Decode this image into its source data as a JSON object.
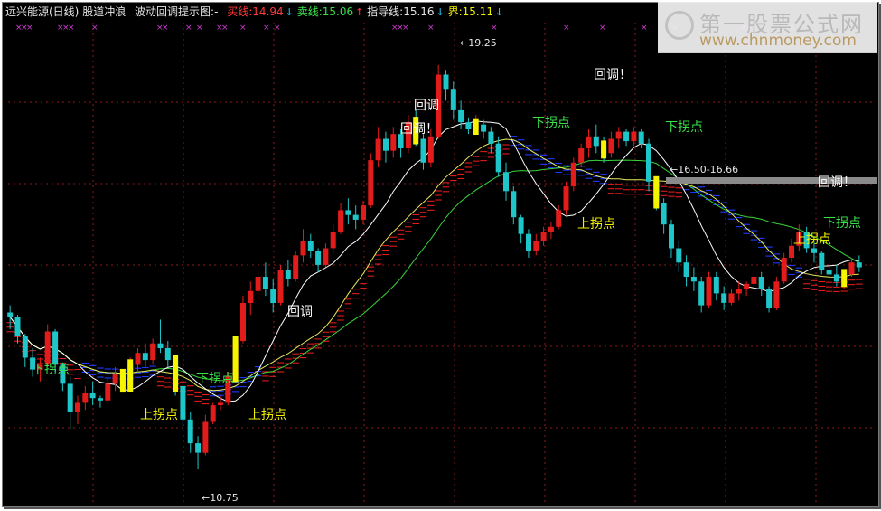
{
  "title_bar": {
    "stock": "远兴能源(日线)",
    "indicator": "股道冲浪",
    "prompt_label": "波动回调提示图:-",
    "buy_label": "买线:",
    "buy_value": "14.94",
    "sell_label": "卖线:",
    "sell_value": "15.06",
    "guide_label": "指导线:",
    "guide_value": "15.16",
    "bound_label": "界:",
    "bound_value": "15.11"
  },
  "watermark": {
    "cn": "第一股票公式网",
    "en": "www.chnmoney.com"
  },
  "colors": {
    "background": "#000000",
    "up": "#e21b1b",
    "down": "#1fc6c9",
    "signal": "#f5f500",
    "ma_white": "#ffffff",
    "ma_yellow": "#e8e860",
    "ma_green": "#39d43a",
    "band_blue": "#1f3aff",
    "band_red": "#e21b1b",
    "grid": "#8a1a1a"
  },
  "chart_data": {
    "type": "candlestick",
    "period": "daily",
    "high_label": "19.25",
    "low_label": "10.75",
    "range_label": "16.50-16.66",
    "annotations": [
      {
        "text": "下拐点",
        "color": "#39e14b"
      },
      {
        "text": "上拐点",
        "color": "#f2f200"
      },
      {
        "text": "下拐点",
        "color": "#39e14b"
      },
      {
        "text": "上拐点",
        "color": "#f2f200"
      },
      {
        "text": "回调",
        "color": "#ffffff"
      },
      {
        "text": "回调！",
        "color": "#ffffff"
      },
      {
        "text": "回调",
        "color": "#ffffff"
      },
      {
        "text": "下拐点",
        "color": "#39e14b"
      },
      {
        "text": "上拐点",
        "color": "#f2f200"
      },
      {
        "text": "回调！",
        "color": "#ffffff"
      },
      {
        "text": "下拐点",
        "color": "#39e14b"
      },
      {
        "text": "回调！",
        "color": "#ffffff"
      },
      {
        "text": "下拐点",
        "color": "#39e14b"
      },
      {
        "text": "上拐点",
        "color": "#f2f200"
      }
    ],
    "ohlc": [
      [
        14.05,
        14.2,
        13.7,
        13.95
      ],
      [
        13.95,
        14.0,
        13.4,
        13.55
      ],
      [
        13.55,
        13.6,
        12.9,
        13.1
      ],
      [
        13.1,
        13.3,
        12.7,
        12.85
      ],
      [
        12.85,
        13.1,
        12.6,
        12.95
      ],
      [
        12.95,
        13.8,
        12.9,
        13.65
      ],
      [
        13.65,
        13.7,
        12.8,
        12.95
      ],
      [
        12.95,
        13.0,
        12.4,
        12.55
      ],
      [
        12.55,
        12.7,
        11.6,
        11.95
      ],
      [
        11.95,
        12.3,
        11.7,
        12.15
      ],
      [
        12.15,
        12.5,
        12.0,
        12.35
      ],
      [
        12.35,
        12.6,
        12.1,
        12.25
      ],
      [
        12.25,
        12.3,
        12.05,
        12.2
      ],
      [
        12.2,
        12.7,
        12.15,
        12.55
      ],
      [
        12.55,
        12.9,
        12.4,
        12.75
      ],
      [
        12.75,
        12.85,
        12.4,
        12.5
      ],
      [
        12.5,
        13.1,
        12.45,
        12.95
      ],
      [
        12.95,
        13.3,
        12.8,
        13.2
      ],
      [
        13.2,
        13.4,
        12.9,
        13.05
      ],
      [
        13.05,
        13.5,
        12.95,
        13.4
      ],
      [
        13.4,
        13.9,
        13.2,
        13.3
      ],
      [
        13.3,
        13.45,
        12.9,
        13.05
      ],
      [
        13.05,
        13.15,
        12.3,
        12.5
      ],
      [
        12.5,
        12.6,
        11.6,
        11.8
      ],
      [
        11.8,
        11.95,
        11.1,
        11.3
      ],
      [
        11.3,
        11.45,
        10.75,
        11.1
      ],
      [
        11.1,
        11.9,
        11.05,
        11.75
      ],
      [
        11.75,
        12.15,
        11.7,
        12.1
      ],
      [
        12.1,
        12.3,
        12.0,
        12.15
      ],
      [
        12.15,
        12.8,
        12.1,
        12.7
      ],
      [
        12.7,
        13.55,
        12.65,
        13.45
      ],
      [
        13.45,
        14.4,
        13.4,
        14.25
      ],
      [
        14.25,
        14.7,
        14.0,
        14.5
      ],
      [
        14.5,
        14.95,
        14.3,
        14.8
      ],
      [
        14.8,
        15.1,
        14.4,
        14.55
      ],
      [
        14.55,
        14.75,
        14.05,
        14.25
      ],
      [
        14.25,
        15.05,
        14.2,
        14.95
      ],
      [
        14.95,
        15.15,
        14.6,
        14.75
      ],
      [
        14.75,
        15.35,
        14.7,
        15.25
      ],
      [
        15.25,
        15.8,
        15.1,
        15.55
      ],
      [
        15.55,
        15.7,
        15.2,
        15.35
      ],
      [
        15.35,
        15.4,
        14.9,
        15.05
      ],
      [
        15.05,
        15.5,
        15.0,
        15.4
      ],
      [
        15.4,
        15.9,
        15.3,
        15.75
      ],
      [
        15.75,
        16.35,
        15.7,
        16.2
      ],
      [
        16.2,
        16.45,
        15.9,
        16.1
      ],
      [
        16.1,
        16.3,
        15.8,
        16.0
      ],
      [
        16.0,
        16.4,
        15.9,
        16.3
      ],
      [
        16.3,
        17.4,
        16.25,
        17.25
      ],
      [
        17.25,
        17.95,
        17.1,
        17.7
      ],
      [
        17.7,
        17.85,
        17.2,
        17.45
      ],
      [
        17.45,
        17.95,
        17.3,
        17.8
      ],
      [
        17.8,
        17.9,
        17.3,
        17.5
      ],
      [
        17.5,
        18.2,
        17.4,
        18.05
      ],
      [
        18.05,
        18.3,
        17.55,
        17.7
      ],
      [
        17.7,
        17.8,
        17.05,
        17.2
      ],
      [
        17.2,
        17.9,
        17.1,
        17.75
      ],
      [
        17.75,
        19.25,
        17.7,
        19.05
      ],
      [
        19.05,
        19.15,
        18.5,
        18.75
      ],
      [
        18.75,
        18.9,
        18.1,
        18.3
      ],
      [
        18.3,
        18.5,
        17.9,
        18.05
      ],
      [
        18.05,
        18.15,
        17.8,
        17.9
      ],
      [
        17.9,
        18.2,
        17.8,
        18.0
      ],
      [
        18.0,
        18.1,
        17.7,
        17.85
      ],
      [
        17.85,
        17.95,
        17.4,
        17.6
      ],
      [
        17.6,
        17.75,
        16.9,
        17.0
      ],
      [
        17.0,
        17.2,
        16.4,
        16.6
      ],
      [
        16.6,
        16.7,
        15.9,
        16.05
      ],
      [
        16.05,
        16.1,
        15.5,
        15.7
      ],
      [
        15.7,
        15.8,
        15.2,
        15.35
      ],
      [
        15.35,
        15.7,
        15.25,
        15.55
      ],
      [
        15.55,
        15.85,
        15.45,
        15.75
      ],
      [
        15.75,
        15.95,
        15.6,
        15.85
      ],
      [
        15.85,
        16.3,
        15.8,
        16.2
      ],
      [
        16.2,
        16.8,
        16.1,
        16.7
      ],
      [
        16.7,
        17.3,
        16.6,
        17.2
      ],
      [
        17.2,
        17.6,
        17.1,
        17.5
      ],
      [
        17.5,
        17.9,
        17.3,
        17.75
      ],
      [
        17.75,
        18.0,
        17.4,
        17.55
      ],
      [
        17.55,
        17.75,
        17.2,
        17.4
      ],
      [
        17.4,
        17.85,
        17.3,
        17.7
      ],
      [
        17.7,
        17.95,
        17.5,
        17.85
      ],
      [
        17.85,
        17.9,
        17.55,
        17.65
      ],
      [
        17.65,
        17.95,
        17.55,
        17.85
      ],
      [
        17.85,
        17.9,
        17.5,
        17.6
      ],
      [
        17.6,
        17.7,
        16.6,
        16.8
      ],
      [
        16.8,
        16.9,
        16.2,
        16.35
      ],
      [
        16.35,
        16.45,
        15.7,
        15.9
      ],
      [
        15.9,
        16.0,
        15.2,
        15.4
      ],
      [
        15.4,
        15.55,
        14.9,
        15.1
      ],
      [
        15.1,
        15.25,
        14.6,
        14.8
      ],
      [
        14.8,
        15.0,
        14.5,
        14.7
      ],
      [
        14.7,
        14.8,
        14.05,
        14.2
      ],
      [
        14.2,
        14.9,
        14.15,
        14.8
      ],
      [
        14.8,
        14.9,
        14.3,
        14.45
      ],
      [
        14.45,
        14.6,
        14.1,
        14.25
      ],
      [
        14.25,
        14.55,
        14.2,
        14.45
      ],
      [
        14.45,
        14.7,
        14.3,
        14.55
      ],
      [
        14.55,
        14.7,
        14.4,
        14.65
      ],
      [
        14.65,
        14.95,
        14.6,
        14.8
      ],
      [
        14.8,
        14.9,
        14.4,
        14.55
      ],
      [
        14.55,
        14.6,
        14.05,
        14.15
      ],
      [
        14.15,
        14.8,
        14.1,
        14.7
      ],
      [
        14.7,
        15.3,
        14.65,
        15.2
      ],
      [
        15.2,
        15.6,
        15.1,
        15.45
      ],
      [
        15.45,
        15.9,
        15.35,
        15.75
      ],
      [
        15.75,
        15.85,
        15.3,
        15.4
      ],
      [
        15.4,
        15.55,
        15.1,
        15.3
      ],
      [
        15.3,
        15.35,
        14.85,
        14.95
      ],
      [
        14.95,
        15.1,
        14.75,
        14.85
      ],
      [
        14.85,
        15.05,
        14.6,
        14.7
      ],
      [
        14.7,
        14.9,
        14.55,
        14.85
      ],
      [
        14.85,
        15.2,
        14.8,
        15.1
      ],
      [
        15.1,
        15.25,
        14.9,
        15.0
      ]
    ]
  }
}
